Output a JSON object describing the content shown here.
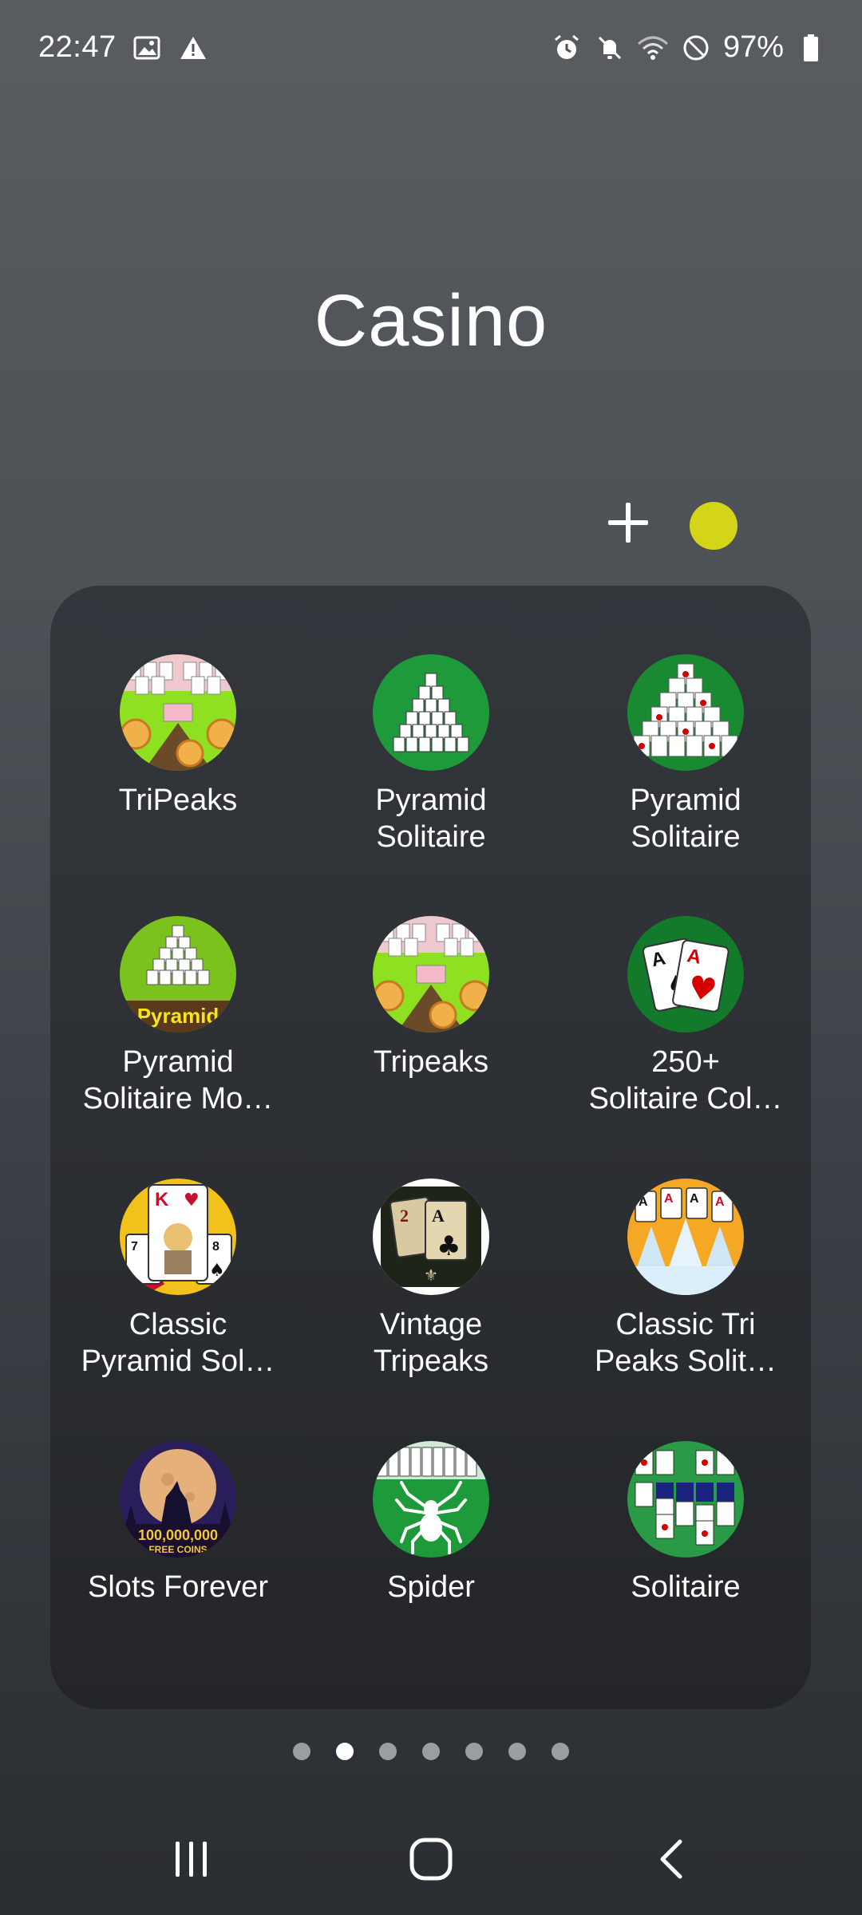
{
  "status_bar": {
    "time": "22:47",
    "battery_percent": "97%",
    "left_icons": [
      "image-notification-icon",
      "warning-icon"
    ],
    "right_icons": [
      "alarm-icon",
      "mute-icon",
      "wifi-icon",
      "do-not-disturb-icon",
      "battery-icon"
    ]
  },
  "folder": {
    "title": "Casino",
    "color": "#d4d418",
    "apps": [
      {
        "line1": "TriPeaks",
        "line2": "",
        "icon": "tripeaks-icon"
      },
      {
        "line1": "Pyramid",
        "line2": "Solitaire",
        "icon": "pyramid-solitaire-green-icon"
      },
      {
        "line1": "Pyramid",
        "line2": "Solitaire",
        "icon": "pyramid-solitaire-cards-icon"
      },
      {
        "line1": "Pyramid",
        "line2": "Solitaire Mo…",
        "icon": "pyramid-solitaire-mountain-icon"
      },
      {
        "line1": "Tripeaks",
        "line2": "",
        "icon": "tripeaks-2-icon"
      },
      {
        "line1": "250+",
        "line2": "Solitaire Col…",
        "icon": "solitaire-collection-icon"
      },
      {
        "line1": "Classic",
        "line2": "Pyramid Sol…",
        "icon": "classic-pyramid-king-icon"
      },
      {
        "line1": "Vintage",
        "line2": "Tripeaks",
        "icon": "vintage-tripeaks-icon"
      },
      {
        "line1": "Classic Tri",
        "line2": "Peaks Solit…",
        "icon": "classic-tripeaks-aces-icon"
      },
      {
        "line1": "Slots Forever",
        "line2": "",
        "icon": "slots-wolf-icon"
      },
      {
        "line1": "Spider",
        "line2": "",
        "icon": "spider-icon"
      },
      {
        "line1": "Solitaire",
        "line2": "",
        "icon": "solitaire-icon"
      }
    ],
    "slots_icon_text": [
      "100,000,000",
      "FREE COINS"
    ],
    "pyramid_icon_text": "Pyramid"
  },
  "pager": {
    "total": 7,
    "active": 2
  },
  "nav": {
    "recents": "recents-icon",
    "home": "home-icon",
    "back": "back-icon"
  }
}
